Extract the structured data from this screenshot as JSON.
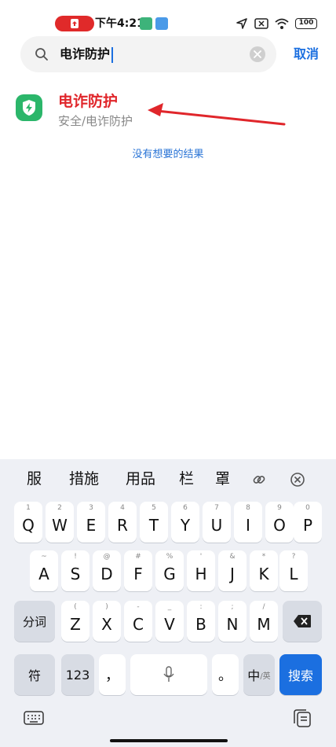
{
  "status_bar": {
    "time": "下午4:21",
    "battery": "100"
  },
  "search": {
    "query": "电诈防护",
    "cancel_label": "取消"
  },
  "result": {
    "title": "电诈防护",
    "subtitle": "安全/电诈防护"
  },
  "no_result_text": "没有想要的结果",
  "keyboard": {
    "candidates": [
      "服",
      "措施",
      "用品",
      "栏",
      "罩"
    ],
    "row1": [
      {
        "hint": "1",
        "key": "Q"
      },
      {
        "hint": "2",
        "key": "W"
      },
      {
        "hint": "3",
        "key": "E"
      },
      {
        "hint": "4",
        "key": "R"
      },
      {
        "hint": "5",
        "key": "T"
      },
      {
        "hint": "6",
        "key": "Y"
      },
      {
        "hint": "7",
        "key": "U"
      },
      {
        "hint": "8",
        "key": "I"
      },
      {
        "hint": "9",
        "key": "O"
      },
      {
        "hint": "0",
        "key": "P"
      }
    ],
    "row2": [
      {
        "hint": "~",
        "key": "A"
      },
      {
        "hint": "!",
        "key": "S"
      },
      {
        "hint": "@",
        "key": "D"
      },
      {
        "hint": "#",
        "key": "F"
      },
      {
        "hint": "%",
        "key": "G"
      },
      {
        "hint": "'",
        "key": "H"
      },
      {
        "hint": "&",
        "key": "J"
      },
      {
        "hint": "*",
        "key": "K"
      },
      {
        "hint": "?",
        "key": "L"
      }
    ],
    "row3": [
      {
        "hint": "(",
        "key": "Z"
      },
      {
        "hint": ")",
        "key": "X"
      },
      {
        "hint": "-",
        "key": "C"
      },
      {
        "hint": "_",
        "key": "V"
      },
      {
        "hint": ":",
        "key": "B"
      },
      {
        "hint": ";",
        "key": "N"
      },
      {
        "hint": "/",
        "key": "M"
      }
    ],
    "fen_ci": "分词",
    "symbol": "符",
    "num": "123",
    "comma": "，",
    "period": "。",
    "lang_main": "中",
    "lang_sub": "/英",
    "search_key": "搜索"
  },
  "colors": {
    "accent": "#1b6fe0",
    "result_title": "#e0262b",
    "app_icon": "#2bb66a",
    "annotation_arrow": "#e0262b"
  }
}
